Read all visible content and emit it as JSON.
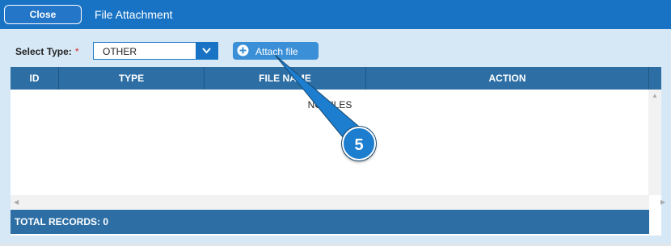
{
  "titlebar": {
    "close_label": "Close",
    "title": "File Attachment"
  },
  "toolbar": {
    "select_type_label": "Select Type:",
    "required_marker": "*",
    "select_value": "OTHER",
    "attach_label": "Attach file"
  },
  "grid": {
    "columns": [
      "ID",
      "TYPE",
      "FILE NAME",
      "ACTION"
    ],
    "empty_message": "NO FILES",
    "footer": "TOTAL RECORDS: 0"
  },
  "callout": {
    "step": "5"
  },
  "colors": {
    "accent": "#1973c4",
    "header": "#2d6fa5",
    "panel": "#d6e8f6"
  },
  "icons": [
    "plus-circle-icon",
    "chevron-down-icon",
    "scroll-up-icon",
    "scroll-left-icon",
    "scroll-right-icon"
  ]
}
